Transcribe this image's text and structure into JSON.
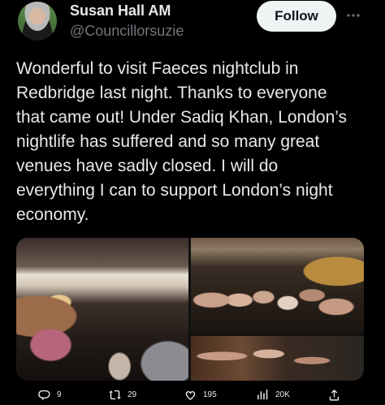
{
  "author": {
    "display_name": "Susan Hall AM",
    "handle": "@Councillorsuzie"
  },
  "follow_button": {
    "label": "Follow"
  },
  "tweet": {
    "text": "Wonderful to visit Faeces nightclub in\nRedbridge last night. Thanks to everyone\nthat came out! Under Sadiq Khan, London’s\nnightlife has suffered and so many great\nvenues have sadly closed. I will do\neverything I can to support London’s night\neconomy."
  },
  "actions": {
    "replies": "9",
    "retweets": "29",
    "likes": "195",
    "views": "20K"
  },
  "icons": {
    "more": "more-horizontal-icon",
    "reply": "reply-icon",
    "retweet": "retweet-icon",
    "like": "heart-icon",
    "views": "views-chart-icon",
    "share": "share-icon"
  },
  "colors": {
    "background": "#000000",
    "text": "#e7e9ea",
    "secondary_text": "#71767b",
    "follow_button_bg": "#eff3f4"
  }
}
